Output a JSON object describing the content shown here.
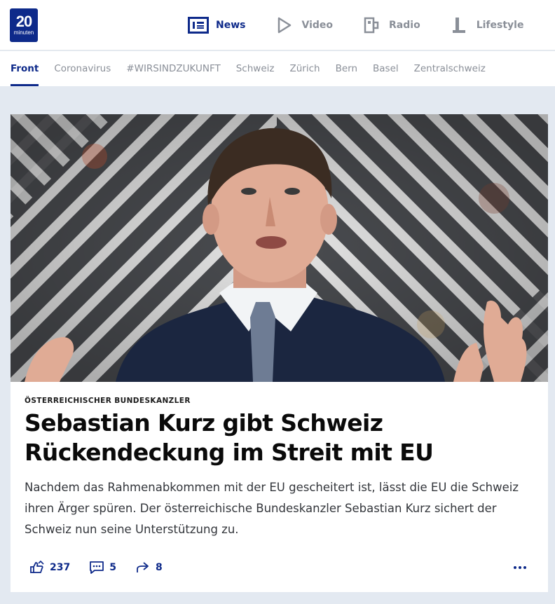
{
  "logo": {
    "number": "20",
    "word": "minuten"
  },
  "main_nav": [
    {
      "label": "News",
      "icon": "news-icon",
      "active": true
    },
    {
      "label": "Video",
      "icon": "play-icon",
      "active": false
    },
    {
      "label": "Radio",
      "icon": "radio-icon",
      "active": false
    },
    {
      "label": "Lifestyle",
      "icon": "lifestyle-icon",
      "active": false
    }
  ],
  "sub_nav": [
    {
      "label": "Front",
      "active": true
    },
    {
      "label": "Coronavirus",
      "active": false
    },
    {
      "label": "#WIRSINDZUKUNFT",
      "active": false
    },
    {
      "label": "Schweiz",
      "active": false
    },
    {
      "label": "Zürich",
      "active": false
    },
    {
      "label": "Bern",
      "active": false
    },
    {
      "label": "Basel",
      "active": false
    },
    {
      "label": "Zentralschweiz",
      "active": false
    }
  ],
  "article": {
    "kicker": "ÖSTERREICHISCHER BUNDESKANZLER",
    "headline": "Sebastian Kurz gibt Schweiz Rückendeckung im Streit mit EU",
    "lead": "Nachdem das Rahmenabkommen mit der EU gescheitert ist, lässt die EU die Schweiz ihren Ärger spüren. Der österreichische Bundeskanzler Sebastian Kurz sichert der Schweiz nun seine Unterstützung zu.",
    "reactions": "237",
    "comments": "5",
    "shares": "8"
  },
  "colors": {
    "brand": "#0e2a8a",
    "muted": "#8a8f98",
    "page_bg": "#e3e9f1"
  }
}
